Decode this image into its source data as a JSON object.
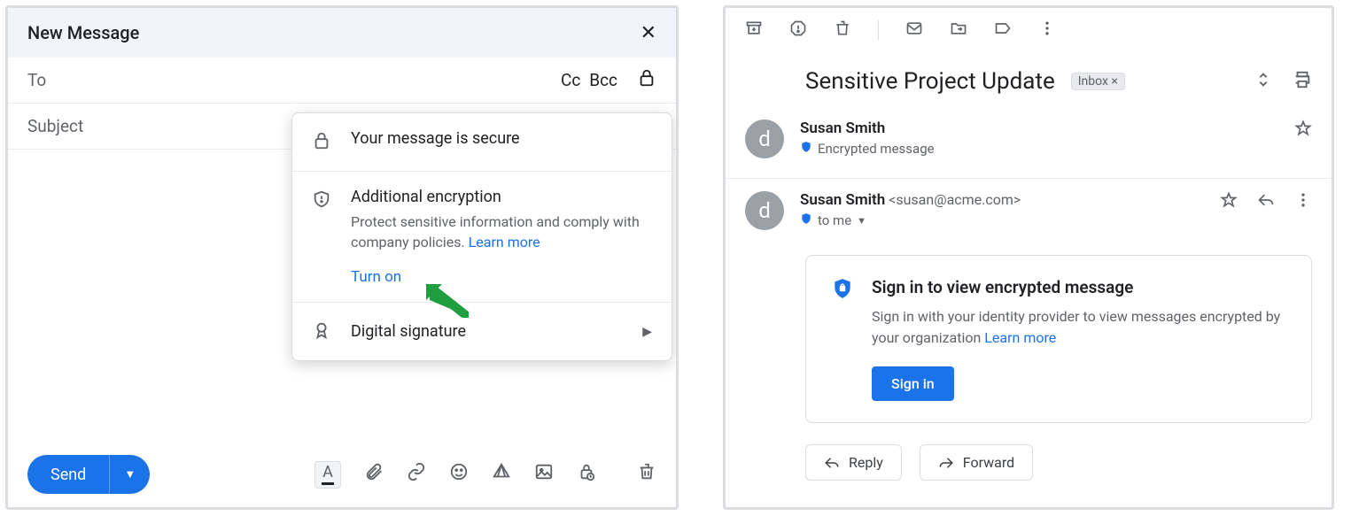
{
  "compose": {
    "title": "New Message",
    "to_label": "To",
    "cc": "Cc",
    "bcc": "Bcc",
    "subject_placeholder": "Subject",
    "send": "Send"
  },
  "popover": {
    "secure_title": "Your message is secure",
    "encryption_title": "Additional encryption",
    "encryption_desc": "Protect sensitive information and comply with company policies. ",
    "learn_more": "Learn more",
    "turn_on": "Turn on",
    "signature_title": "Digital signature"
  },
  "reader": {
    "subject": "Sensitive Project Update",
    "inbox_chip": "Inbox ×",
    "messages": [
      {
        "avatar_initial": "d",
        "name": "Susan Smith",
        "encrypted_line": "Encrypted message"
      },
      {
        "avatar_initial": "d",
        "name": "Susan Smith",
        "address": "<susan@acme.com>",
        "to_line": "to me"
      }
    ],
    "card": {
      "title": "Sign in to view encrypted message",
      "desc": "Sign in with your identity provider to view messages encrypted by your organization ",
      "learn_more": "Learn  more",
      "button": "Sign in"
    },
    "reply": "Reply",
    "forward": "Forward"
  }
}
